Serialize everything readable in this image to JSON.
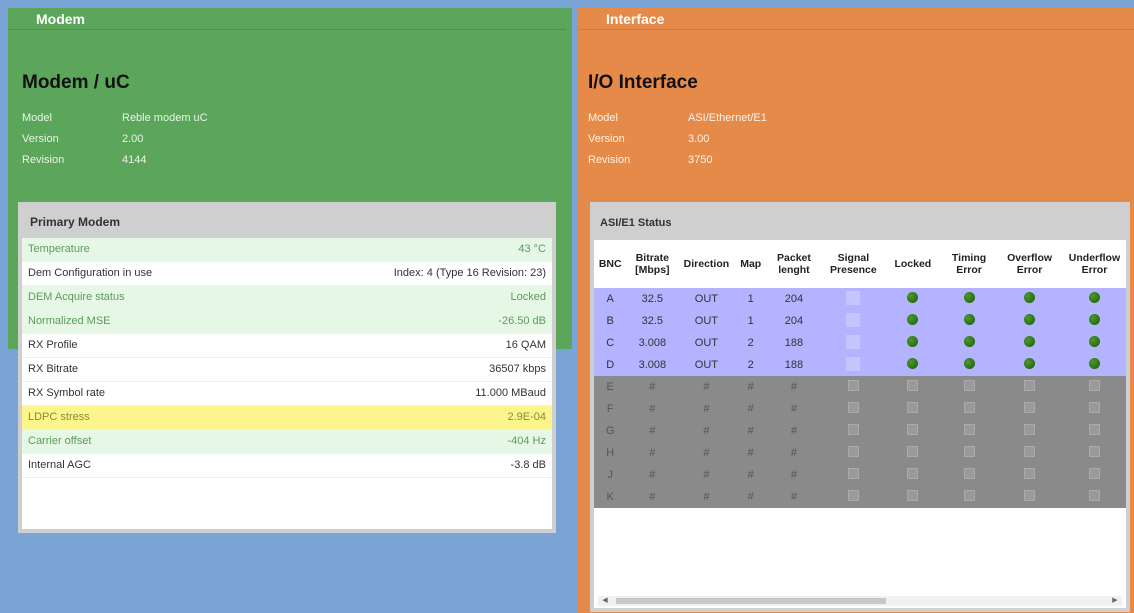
{
  "modem": {
    "tab": "Modem",
    "title": "Modem / uC",
    "info": [
      {
        "label": "Model",
        "value": "Reble modem uC"
      },
      {
        "label": "Version",
        "value": "2.00"
      },
      {
        "label": "Revision",
        "value": "4144"
      }
    ],
    "primary": {
      "title": "Primary Modem",
      "rows": [
        {
          "label": "Temperature",
          "value": "43 °C",
          "style": "green"
        },
        {
          "label": "Dem Configuration in use",
          "value": "Index: 4 (Type 16 Revision: 23)",
          "style": "white"
        },
        {
          "label": "DEM Acquire status",
          "value": "Locked",
          "style": "green"
        },
        {
          "label": "Normalized MSE",
          "value": "-26.50 dB",
          "style": "green"
        },
        {
          "label": "RX Profile",
          "value": "16 QAM",
          "style": "white"
        },
        {
          "label": "RX Bitrate",
          "value": "36507 kbps",
          "style": "white"
        },
        {
          "label": "RX Symbol rate",
          "value": "11.000 MBaud",
          "style": "white"
        },
        {
          "label": "LDPC stress",
          "value": "2.9E-04",
          "style": "yellow"
        },
        {
          "label": "Carrier offset",
          "value": "-404 Hz",
          "style": "green"
        },
        {
          "label": "Internal AGC",
          "value": "-3.8 dB",
          "style": "white"
        }
      ]
    }
  },
  "interface": {
    "tab": "Interface",
    "title": "I/O Interface",
    "info": [
      {
        "label": "Model",
        "value": "ASI/Ethernet/E1"
      },
      {
        "label": "Version",
        "value": "3.00"
      },
      {
        "label": "Revision",
        "value": "3750"
      }
    ],
    "asi": {
      "title": "ASI/E1 Status",
      "headers": [
        "BNC",
        "Bitrate [Mbps]",
        "Direction",
        "Map",
        "Packet lenght",
        "Signal Presence",
        "Locked",
        "Timing Error",
        "Overflow Error",
        "Underflow Error"
      ],
      "rows": [
        {
          "bnc": "A",
          "bitrate": "32.5",
          "direction": "OUT",
          "map": "1",
          "packet": "204",
          "active": true
        },
        {
          "bnc": "B",
          "bitrate": "32.5",
          "direction": "OUT",
          "map": "1",
          "packet": "204",
          "active": true
        },
        {
          "bnc": "C",
          "bitrate": "3.008",
          "direction": "OUT",
          "map": "2",
          "packet": "188",
          "active": true
        },
        {
          "bnc": "D",
          "bitrate": "3.008",
          "direction": "OUT",
          "map": "2",
          "packet": "188",
          "active": true
        },
        {
          "bnc": "E",
          "bitrate": "#",
          "direction": "#",
          "map": "#",
          "packet": "#",
          "active": false
        },
        {
          "bnc": "F",
          "bitrate": "#",
          "direction": "#",
          "map": "#",
          "packet": "#",
          "active": false
        },
        {
          "bnc": "G",
          "bitrate": "#",
          "direction": "#",
          "map": "#",
          "packet": "#",
          "active": false
        },
        {
          "bnc": "H",
          "bitrate": "#",
          "direction": "#",
          "map": "#",
          "packet": "#",
          "active": false
        },
        {
          "bnc": "J",
          "bitrate": "#",
          "direction": "#",
          "map": "#",
          "packet": "#",
          "active": false
        },
        {
          "bnc": "K",
          "bitrate": "#",
          "direction": "#",
          "map": "#",
          "packet": "#",
          "active": false
        }
      ]
    }
  }
}
